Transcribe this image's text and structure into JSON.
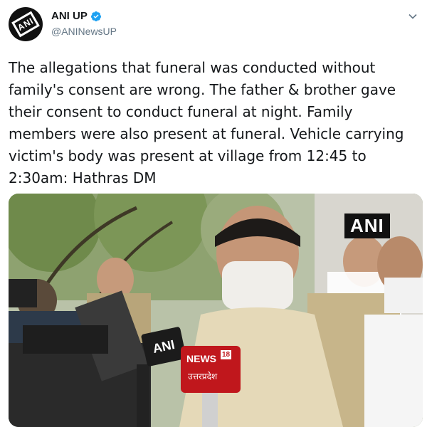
{
  "tweet": {
    "display_name": "ANI UP",
    "handle": "@ANINewsUP",
    "avatar_text": "ANI",
    "text": "The allegations that funeral was conducted without family's consent are wrong. The father & brother gave their consent to conduct funeral at night. Family members were also present at funeral. Vehicle carrying victim's body was present at village from 12:45 to 2:30am: Hathras DM"
  },
  "media": {
    "watermark": "ANI",
    "mic_ani_label": "ANI",
    "mic_news_label": "NEWS",
    "mic_news_number": "18",
    "mic_news_region": "उत्तरप्रदेश"
  },
  "colors": {
    "verified": "#1da1f2",
    "handle": "#657786",
    "news18_red": "#c0171c"
  },
  "icons": {
    "verified": "verified-badge-icon",
    "menu": "chevron-down-icon"
  }
}
